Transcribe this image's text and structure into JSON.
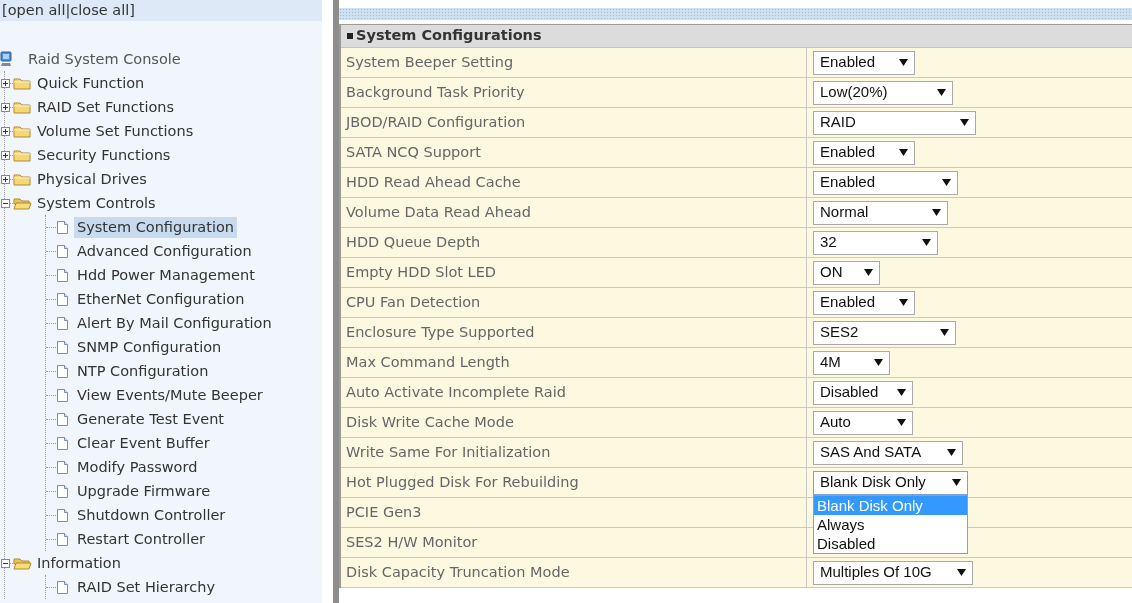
{
  "tree_links": {
    "open_bracket": "[",
    "links": [
      "open all",
      "close all"
    ],
    "separator": "|",
    "close_bracket": "]"
  },
  "tree": {
    "root": "Raid System Console",
    "items": [
      {
        "label": "Quick Function",
        "expanded": false
      },
      {
        "label": "RAID Set Functions",
        "expanded": false
      },
      {
        "label": "Volume Set Functions",
        "expanded": false
      },
      {
        "label": "Security Functions",
        "expanded": false
      },
      {
        "label": "Physical Drives",
        "expanded": false
      },
      {
        "label": "System Controls",
        "expanded": true,
        "children": [
          {
            "label": "System Configuration",
            "selected": true
          },
          {
            "label": "Advanced Configuration",
            "selected": false
          },
          {
            "label": "Hdd Power Management",
            "selected": false
          },
          {
            "label": "EtherNet Configuration",
            "selected": false
          },
          {
            "label": "Alert By Mail Configuration",
            "selected": false
          },
          {
            "label": "SNMP Configuration",
            "selected": false
          },
          {
            "label": "NTP Configuration",
            "selected": false
          },
          {
            "label": "View Events/Mute Beeper",
            "selected": false
          },
          {
            "label": "Generate Test Event",
            "selected": false
          },
          {
            "label": "Clear Event Buffer",
            "selected": false
          },
          {
            "label": "Modify Password",
            "selected": false
          },
          {
            "label": "Upgrade Firmware",
            "selected": false
          },
          {
            "label": "Shutdown Controller",
            "selected": false
          },
          {
            "label": "Restart Controller",
            "selected": false
          }
        ]
      },
      {
        "label": "Information",
        "expanded": true,
        "children": [
          {
            "label": "RAID Set Hierarchy",
            "selected": false
          }
        ]
      }
    ]
  },
  "panel": {
    "title": "System Configurations",
    "rows": [
      {
        "label": "System Beeper Setting",
        "value": "Enabled"
      },
      {
        "label": "Background Task Priority",
        "value": "Low(20%)"
      },
      {
        "label": "JBOD/RAID Configuration",
        "value": "RAID"
      },
      {
        "label": "SATA NCQ Support",
        "value": "Enabled"
      },
      {
        "label": "HDD Read Ahead Cache",
        "value": "Enabled"
      },
      {
        "label": "Volume Data Read Ahead",
        "value": "Normal"
      },
      {
        "label": "HDD Queue Depth",
        "value": "32"
      },
      {
        "label": "Empty HDD Slot LED",
        "value": "ON"
      },
      {
        "label": "CPU Fan Detection",
        "value": "Enabled"
      },
      {
        "label": "Enclosure Type Supported",
        "value": "SES2"
      },
      {
        "label": "Max Command Length",
        "value": "4M"
      },
      {
        "label": "Auto Activate Incomplete Raid",
        "value": "Disabled"
      },
      {
        "label": "Disk Write Cache Mode",
        "value": "Auto"
      },
      {
        "label": "Write Same For Initialization",
        "value": "SAS And SATA"
      },
      {
        "label": "Hot Plugged Disk For Rebuilding",
        "value": "Blank Disk Only",
        "expanded": true,
        "options": [
          {
            "label": "Blank Disk Only",
            "selected": true
          },
          {
            "label": "Always",
            "selected": false
          },
          {
            "label": "Disabled",
            "selected": false
          }
        ]
      },
      {
        "label": "PCIE Gen3"
      },
      {
        "label": "SES2 H/W Monitor"
      },
      {
        "label": "Disk Capacity Truncation Mode",
        "value": "Multiples Of 10G"
      }
    ]
  }
}
